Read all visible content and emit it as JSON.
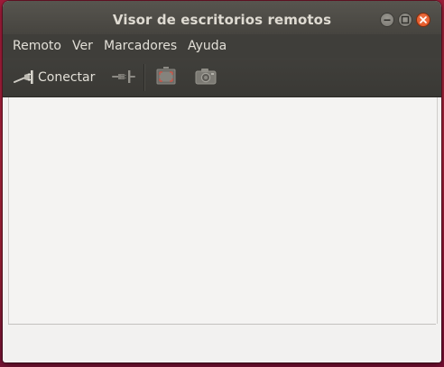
{
  "window": {
    "title": "Visor de escritorios remotos",
    "controls": [
      "minimize-icon",
      "maximize-icon",
      "close-icon"
    ]
  },
  "menubar": {
    "items": [
      {
        "label": "Remoto"
      },
      {
        "label": "Ver"
      },
      {
        "label": "Marcadores"
      },
      {
        "label": "Ayuda"
      }
    ]
  },
  "toolbar": {
    "connect_label": "Conectar",
    "buttons": [
      {
        "icon": "connect-plug-icon",
        "enabled": true
      },
      {
        "icon": "disconnect-plug-icon",
        "enabled": false
      },
      {
        "icon": "fullscreen-icon",
        "enabled": false
      },
      {
        "icon": "screenshot-camera-icon",
        "enabled": false
      }
    ]
  },
  "colors": {
    "titlebar": "#4f4d48",
    "menubar": "#3f3e3a",
    "toolbar": "#3c3b37",
    "close_button": "#e95420",
    "content": "#f4f3f2",
    "desktop": "#a42238"
  }
}
